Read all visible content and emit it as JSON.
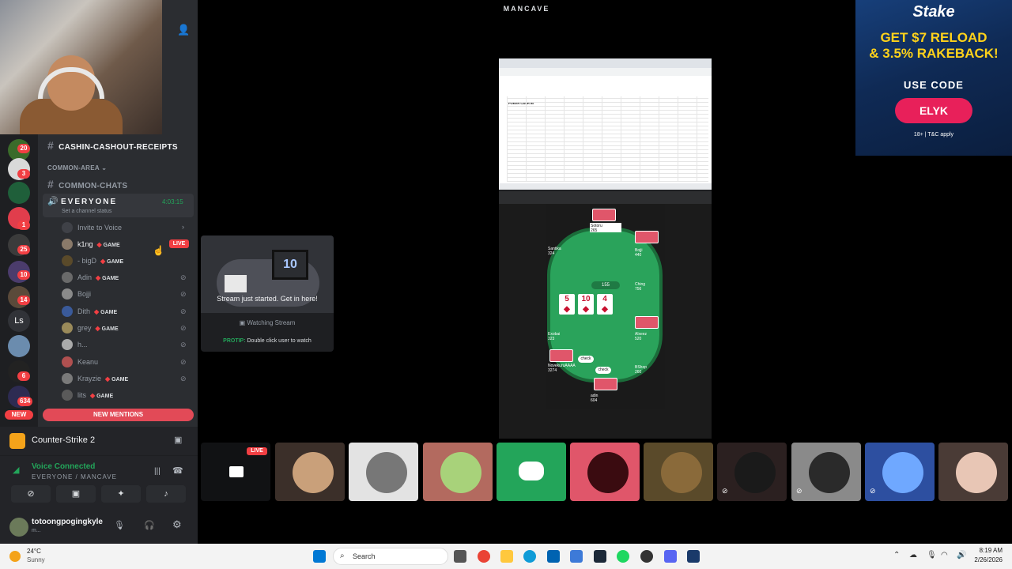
{
  "window": {
    "title": "MANCAVE"
  },
  "sidebar": {
    "channels": [
      {
        "name": "CASHIN-CASHOUT-RECEIPTS"
      },
      {
        "category": "COMMON-AREA"
      },
      {
        "name": "COMMON-CHATS"
      }
    ],
    "voice_channel": {
      "name": "EVERYONE",
      "timer": "4:03:15",
      "status_placeholder": "Set a channel status"
    },
    "invite_label": "Invite to Voice",
    "members": [
      {
        "name": "k1ng",
        "tag": "GAME",
        "live": "LIVE"
      },
      {
        "name": "- bigD",
        "tag": "GAME"
      },
      {
        "name": "Adin",
        "tag": "GAME"
      },
      {
        "name": "Bojji",
        "tag": ""
      },
      {
        "name": "Dith",
        "tag": "GAME"
      },
      {
        "name": "grey",
        "tag": "GAME"
      },
      {
        "name": "h...",
        "tag": ""
      },
      {
        "name": "Keanu",
        "tag": ""
      },
      {
        "name": "Krayzie",
        "tag": "GAME"
      },
      {
        "name": "lits",
        "tag": "GAME"
      }
    ],
    "new_mentions": "NEW MENTIONS",
    "rail_badges": [
      "20",
      "3",
      "1",
      "25",
      "10",
      "14",
      "6",
      "634"
    ],
    "rail_new": "NEW",
    "rail_ls": "Ls"
  },
  "activity": {
    "game": "Counter-Strike 2"
  },
  "voice": {
    "status": "Voice Connected",
    "channel": "EVERYONE / MANCAVE"
  },
  "user": {
    "name": "totoongpogingkyle",
    "sub": "m..."
  },
  "popover": {
    "title": "Stream just started. Get in here!",
    "watching": "Watching Stream",
    "protip_label": "PROTIP:",
    "protip_text": "Double click user to watch",
    "art_number": "10"
  },
  "stream": {
    "pot": "155",
    "board": [
      "5",
      "10",
      "4"
    ],
    "players": [
      {
        "name": "Sotoru",
        "stack": "265"
      },
      {
        "name": "Santika",
        "stack": "324"
      },
      {
        "name": "Bojji",
        "stack": "440"
      },
      {
        "name": "Ching",
        "stack": "756"
      },
      {
        "name": "Exobai",
        "stack": "323"
      },
      {
        "name": "Alxeez",
        "stack": "520"
      },
      {
        "name": "NovekuruAAAA",
        "stack": "3274"
      },
      {
        "name": "BShop",
        "stack": "260"
      },
      {
        "name": "adin",
        "stack": "604"
      }
    ],
    "check": "check",
    "sheet_title": "POKER CASH IN"
  },
  "ad": {
    "brand": "Stake",
    "headline1": "GET $7 RELOAD",
    "headline2": "& 3.5% RAKEBACK!",
    "use_code": "USE CODE",
    "code": "ELYK",
    "fine": "18+ | T&C apply"
  },
  "strip": {
    "live": "LIVE"
  },
  "taskbar": {
    "temp": "24°C",
    "weather": "Sunny",
    "search": "Search",
    "time": "8:19 AM",
    "date": "2/26/2026"
  },
  "colors": {
    "accent": "#5865f2",
    "live": "#f23f43",
    "green": "#23a55a",
    "felt": "#2aa35b"
  }
}
